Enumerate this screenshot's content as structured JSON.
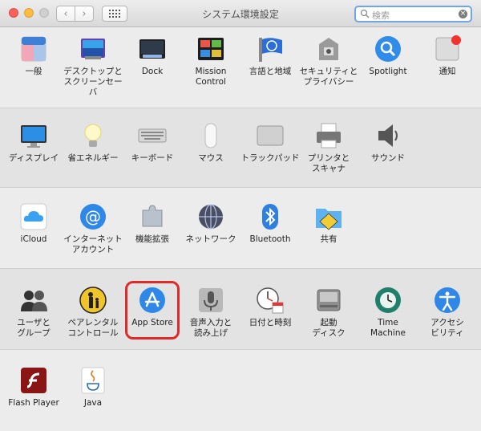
{
  "window": {
    "title": "システム環境設定"
  },
  "toolbar": {
    "back": "‹",
    "forward": "›"
  },
  "search": {
    "placeholder": "検索",
    "clear": "×"
  },
  "sections": [
    [
      {
        "id": "general",
        "label": "一般",
        "icon": "general-icon",
        "icon_text": "File\nNew\nOp"
      },
      {
        "id": "desktop",
        "label": "デスクトップと\nスクリーンセーバ",
        "icon": "desktop-icon"
      },
      {
        "id": "dock",
        "label": "Dock",
        "icon": "dock-icon"
      },
      {
        "id": "mission-control",
        "label": "Mission\nControl",
        "icon": "mission-control-icon"
      },
      {
        "id": "language",
        "label": "言語と地域",
        "icon": "language-region-icon"
      },
      {
        "id": "security",
        "label": "セキュリティと\nプライバシー",
        "icon": "security-icon"
      },
      {
        "id": "spotlight",
        "label": "Spotlight",
        "icon": "spotlight-icon"
      },
      {
        "id": "notifications",
        "label": "通知",
        "icon": "notifications-icon"
      }
    ],
    [
      {
        "id": "display",
        "label": "ディスプレイ",
        "icon": "display-icon"
      },
      {
        "id": "energy",
        "label": "省エネルギー",
        "icon": "energy-saver-icon"
      },
      {
        "id": "keyboard",
        "label": "キーボード",
        "icon": "keyboard-icon"
      },
      {
        "id": "mouse",
        "label": "マウス",
        "icon": "mouse-icon"
      },
      {
        "id": "trackpad",
        "label": "トラックパッド",
        "icon": "trackpad-icon"
      },
      {
        "id": "printers",
        "label": "プリンタと\nスキャナ",
        "icon": "printer-icon"
      },
      {
        "id": "sound",
        "label": "サウンド",
        "icon": "sound-icon"
      }
    ],
    [
      {
        "id": "icloud",
        "label": "iCloud",
        "icon": "icloud-icon"
      },
      {
        "id": "internet-accounts",
        "label": "インターネット\nアカウント",
        "icon": "internet-accounts-icon"
      },
      {
        "id": "extensions",
        "label": "機能拡張",
        "icon": "extensions-icon"
      },
      {
        "id": "network",
        "label": "ネットワーク",
        "icon": "network-icon"
      },
      {
        "id": "bluetooth",
        "label": "Bluetooth",
        "icon": "bluetooth-icon"
      },
      {
        "id": "sharing",
        "label": "共有",
        "icon": "sharing-icon"
      }
    ],
    [
      {
        "id": "users",
        "label": "ユーザと\nグループ",
        "icon": "users-groups-icon"
      },
      {
        "id": "parental",
        "label": "ペアレンタル\nコントロール",
        "icon": "parental-controls-icon"
      },
      {
        "id": "app-store",
        "label": "App Store",
        "icon": "app-store-icon"
      },
      {
        "id": "dictation",
        "label": "音声入力と\n読み上げ",
        "icon": "dictation-icon"
      },
      {
        "id": "date-time",
        "label": "日付と時刻",
        "icon": "date-time-icon",
        "icon_text": "18"
      },
      {
        "id": "startup-disk",
        "label": "起動\nディスク",
        "icon": "startup-disk-icon"
      },
      {
        "id": "time-machine",
        "label": "Time\nMachine",
        "icon": "time-machine-icon"
      },
      {
        "id": "accessibility",
        "label": "アクセシ\nビリティ",
        "icon": "accessibility-icon"
      }
    ],
    [
      {
        "id": "flash",
        "label": "Flash Player",
        "icon": "flash-player-icon",
        "icon_text": "f"
      },
      {
        "id": "java",
        "label": "Java",
        "icon": "java-icon"
      }
    ]
  ],
  "colors": {
    "highlight": "#e02a2a",
    "accent": "#2f88e8"
  }
}
